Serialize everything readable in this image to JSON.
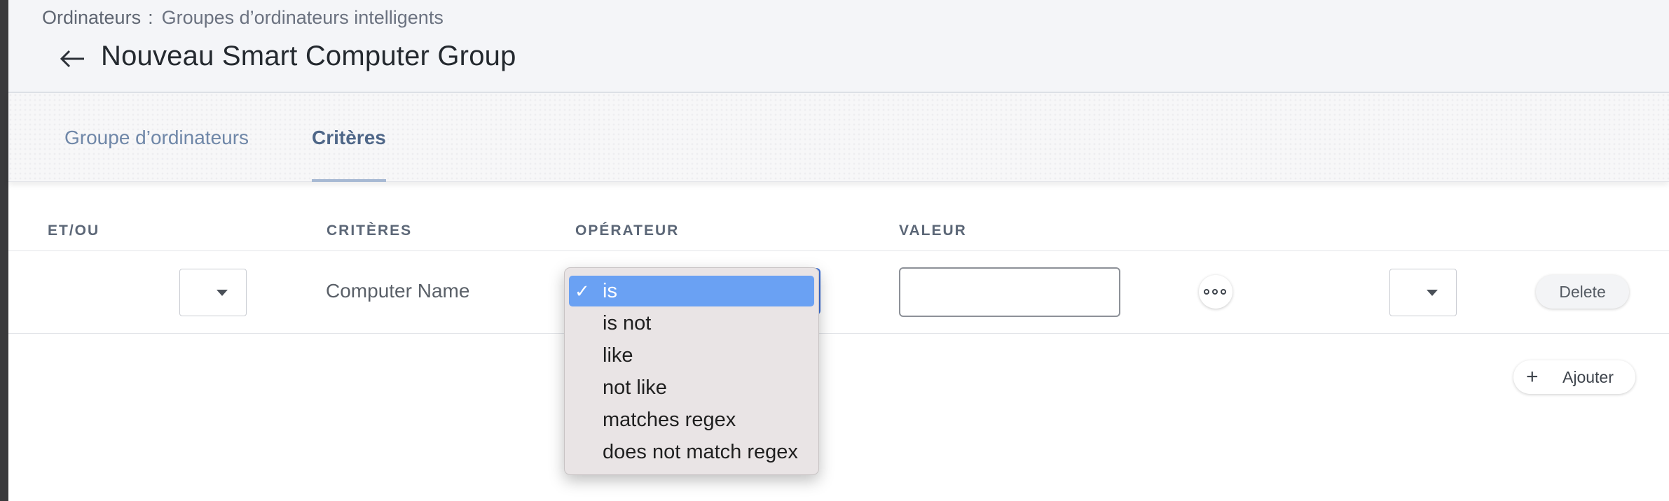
{
  "breadcrumb": {
    "root": "Ordinateurs",
    "separator": ":",
    "current": "Groupes d’ordinateurs intelligents"
  },
  "page": {
    "title": "Nouveau Smart Computer Group",
    "back_icon": "arrow-left-icon"
  },
  "tabs": [
    {
      "label": "Groupe d’ordinateurs",
      "active": false
    },
    {
      "label": "Critères",
      "active": true
    }
  ],
  "table": {
    "headers": {
      "and_or": "ET/OU",
      "criteria": "CRITÈRES",
      "operator": "OPÉRATEUR",
      "value": "VALEUR"
    },
    "row": {
      "criteria": "Computer Name",
      "operator": "is",
      "value": ""
    }
  },
  "operator_dropdown": {
    "check_mark": "✓",
    "options": [
      "is",
      "is not",
      "like",
      "not like",
      "matches regex",
      "does not match regex"
    ],
    "selected": "is"
  },
  "buttons": {
    "delete": "Delete",
    "add_icon": "+",
    "add": "Ajouter"
  },
  "colors": {
    "selected_option": "#6aa1f3",
    "active_tab_underline": "#a7b9d3",
    "tab_text": "#6f87a8"
  }
}
